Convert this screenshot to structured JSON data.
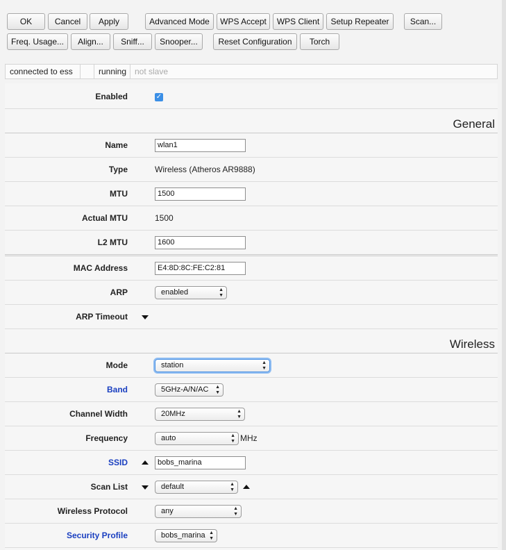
{
  "toolbar": {
    "ok": "OK",
    "cancel": "Cancel",
    "apply": "Apply",
    "advanced_mode": "Advanced Mode",
    "wps_accept": "WPS Accept",
    "wps_client": "WPS Client",
    "setup_repeater": "Setup Repeater",
    "scan": "Scan...",
    "freq_usage": "Freq. Usage...",
    "align": "Align...",
    "sniff": "Sniff...",
    "snooper": "Snooper...",
    "reset_configuration": "Reset Configuration",
    "torch": "Torch"
  },
  "status": {
    "connection": "connected to ess",
    "empty": "",
    "state": "running",
    "slave": "not slave"
  },
  "form": {
    "enabled": {
      "label": "Enabled",
      "checked": true,
      "check_glyph": "✓"
    },
    "general_title": "General",
    "name": {
      "label": "Name",
      "value": "wlan1"
    },
    "type": {
      "label": "Type",
      "value": "Wireless (Atheros AR9888)"
    },
    "mtu": {
      "label": "MTU",
      "value": "1500"
    },
    "actual_mtu": {
      "label": "Actual MTU",
      "value": "1500"
    },
    "l2_mtu": {
      "label": "L2 MTU",
      "value": "1600"
    },
    "mac_address": {
      "label": "MAC Address",
      "value": "E4:8D:8C:FE:C2:81"
    },
    "arp": {
      "label": "ARP",
      "value": "enabled"
    },
    "arp_timeout": {
      "label": "ARP Timeout"
    },
    "wireless_title": "Wireless",
    "mode": {
      "label": "Mode",
      "value": "station"
    },
    "band": {
      "label": "Band",
      "value": "5GHz-A/N/AC"
    },
    "channel_width": {
      "label": "Channel Width",
      "value": "20MHz"
    },
    "frequency": {
      "label": "Frequency",
      "value": "auto",
      "unit": "MHz"
    },
    "ssid": {
      "label": "SSID",
      "value": "bobs_marina"
    },
    "scan_list": {
      "label": "Scan List",
      "value": "default"
    },
    "wireless_protocol": {
      "label": "Wireless Protocol",
      "value": "any"
    },
    "security_profile": {
      "label": "Security Profile",
      "value": "bobs_marina"
    }
  },
  "icons": {
    "select_arrows": "▲▼",
    "expand": "triangle-down-icon",
    "collapse": "triangle-up-icon"
  },
  "colors": {
    "link_label": "#1a3fc0",
    "checkbox": "#3b8fe6",
    "focus": "#4a90e2"
  }
}
